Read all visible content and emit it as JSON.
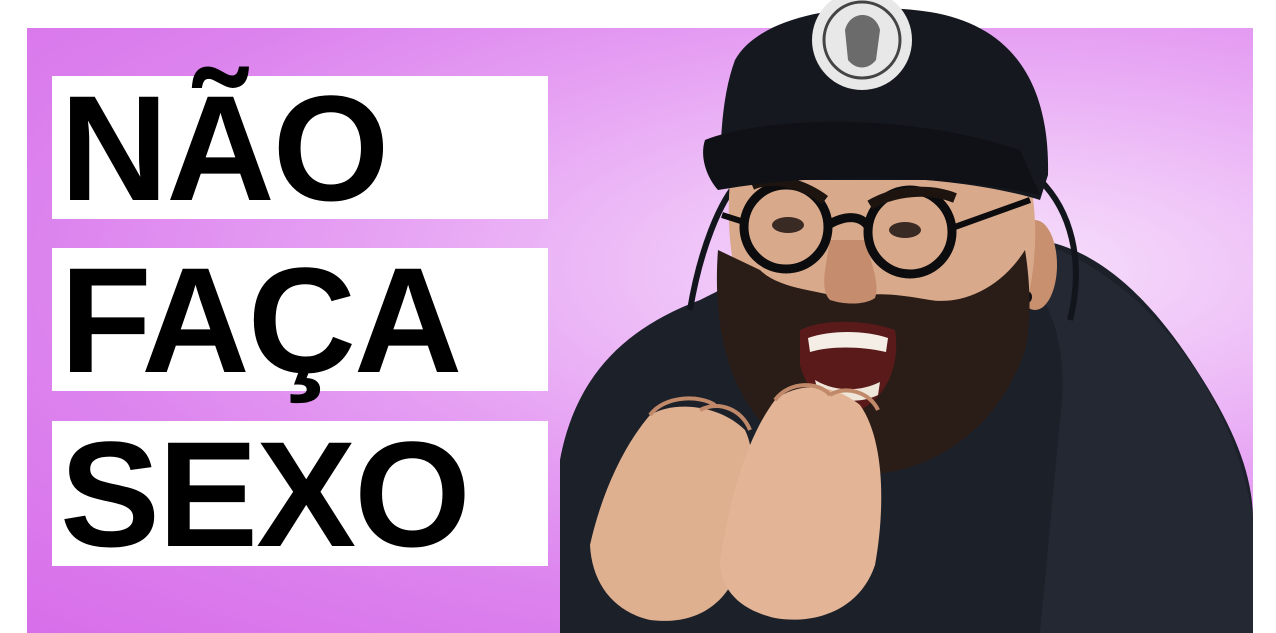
{
  "title_lines": [
    "NÃO",
    "FAÇA",
    "SEXO"
  ],
  "colors": {
    "background_accent": "#dc83ee",
    "background_glow": "#f7e2fb",
    "text": "#000000",
    "text_box": "#ffffff",
    "hoodie": "#1c2029",
    "cap": "#15181f",
    "skin": "#d9a98b",
    "beard": "#2a1d17"
  }
}
